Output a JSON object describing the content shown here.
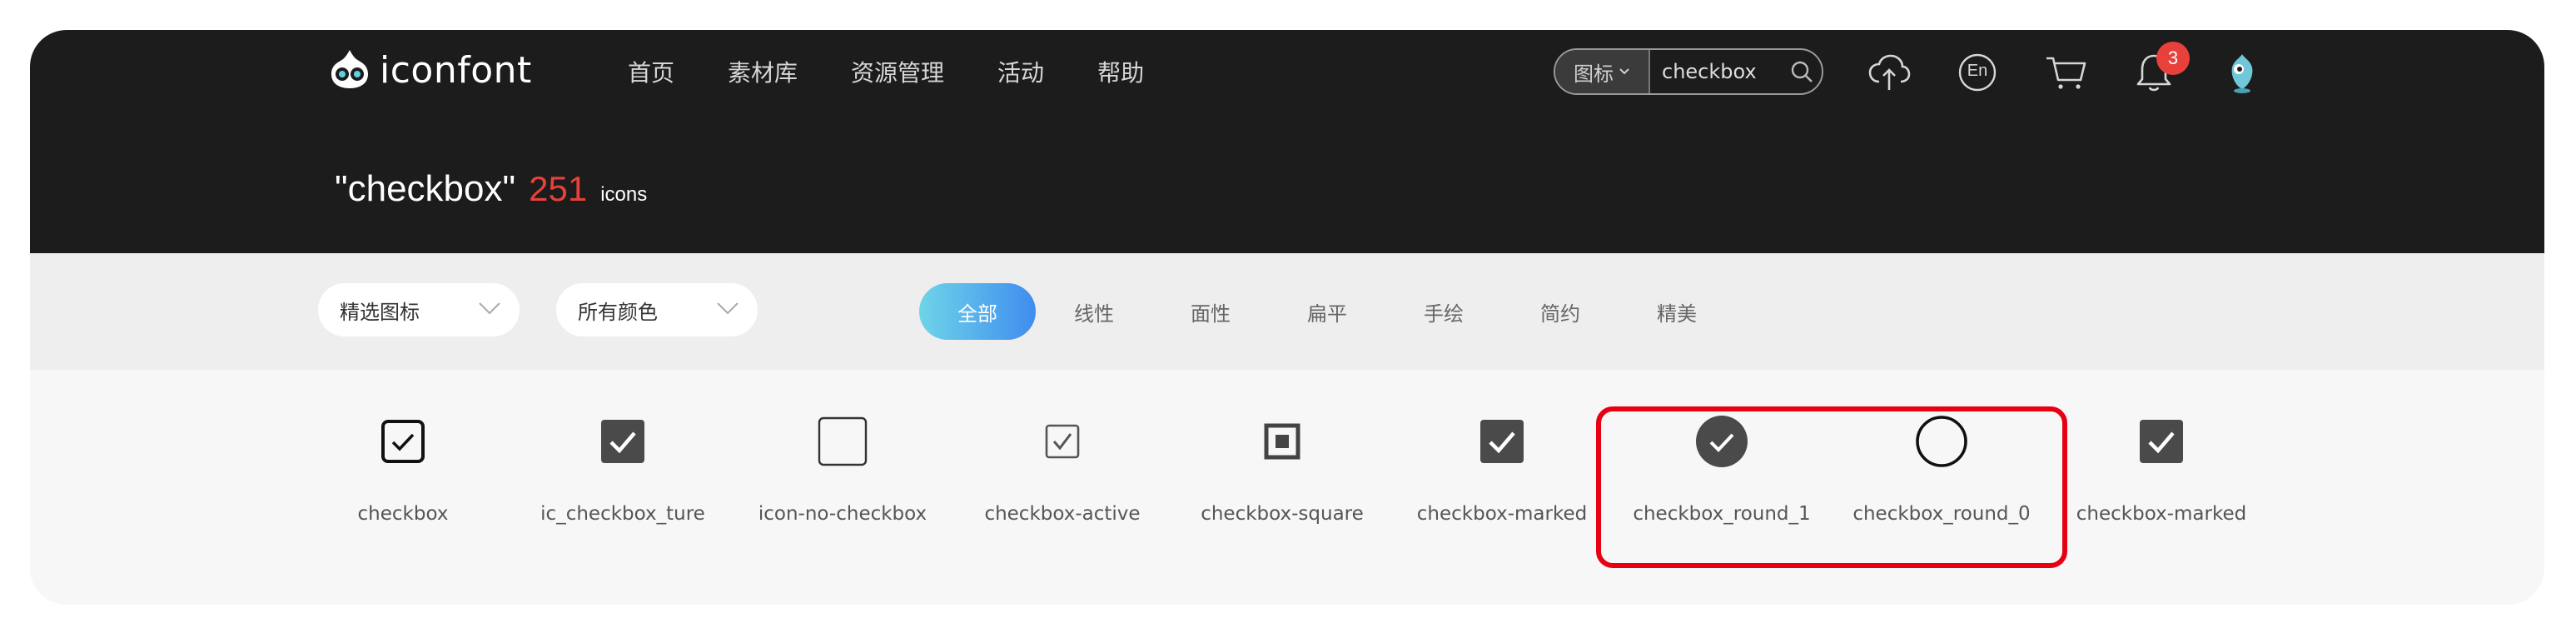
{
  "header": {
    "logo_text": "iconfont",
    "nav": [
      {
        "label": "首页"
      },
      {
        "label": "素材库"
      },
      {
        "label": "资源管理"
      },
      {
        "label": "活动"
      },
      {
        "label": "帮助"
      }
    ],
    "search": {
      "type_label": "图标",
      "value": "checkbox"
    },
    "notifications_count": "3",
    "language_label": "En",
    "result": {
      "query": "\"checkbox\"",
      "count": "251",
      "unit": "icons"
    }
  },
  "filters": {
    "dropdown_1": "精选图标",
    "dropdown_2": "所有颜色",
    "tabs": [
      {
        "label": "全部",
        "active": true
      },
      {
        "label": "线性"
      },
      {
        "label": "面性"
      },
      {
        "label": "扁平"
      },
      {
        "label": "手绘"
      },
      {
        "label": "简约"
      },
      {
        "label": "精美"
      }
    ]
  },
  "icons": [
    {
      "name": "checkbox",
      "icon": "checkbox-outline-check-icon"
    },
    {
      "name": "ic_checkbox_ture",
      "icon": "checkbox-filled-check-icon"
    },
    {
      "name": "icon-no-checkbox",
      "icon": "checkbox-empty-icon"
    },
    {
      "name": "checkbox-active",
      "icon": "checkbox-small-check-icon"
    },
    {
      "name": "checkbox-square",
      "icon": "checkbox-square-icon"
    },
    {
      "name": "checkbox-marked",
      "icon": "checkbox-filled-check-icon"
    },
    {
      "name": "checkbox_round_1",
      "icon": "round-filled-check-icon"
    },
    {
      "name": "checkbox_round_0",
      "icon": "round-empty-icon"
    },
    {
      "name": "checkbox-marked",
      "icon": "checkbox-filled-check-icon"
    }
  ],
  "colors": {
    "header_bg": "#1c1c1c",
    "accent_red": "#e8413b",
    "highlight_red": "#e60012",
    "tab_gradient_start": "#6fd4e8",
    "tab_gradient_end": "#3f8df0"
  }
}
